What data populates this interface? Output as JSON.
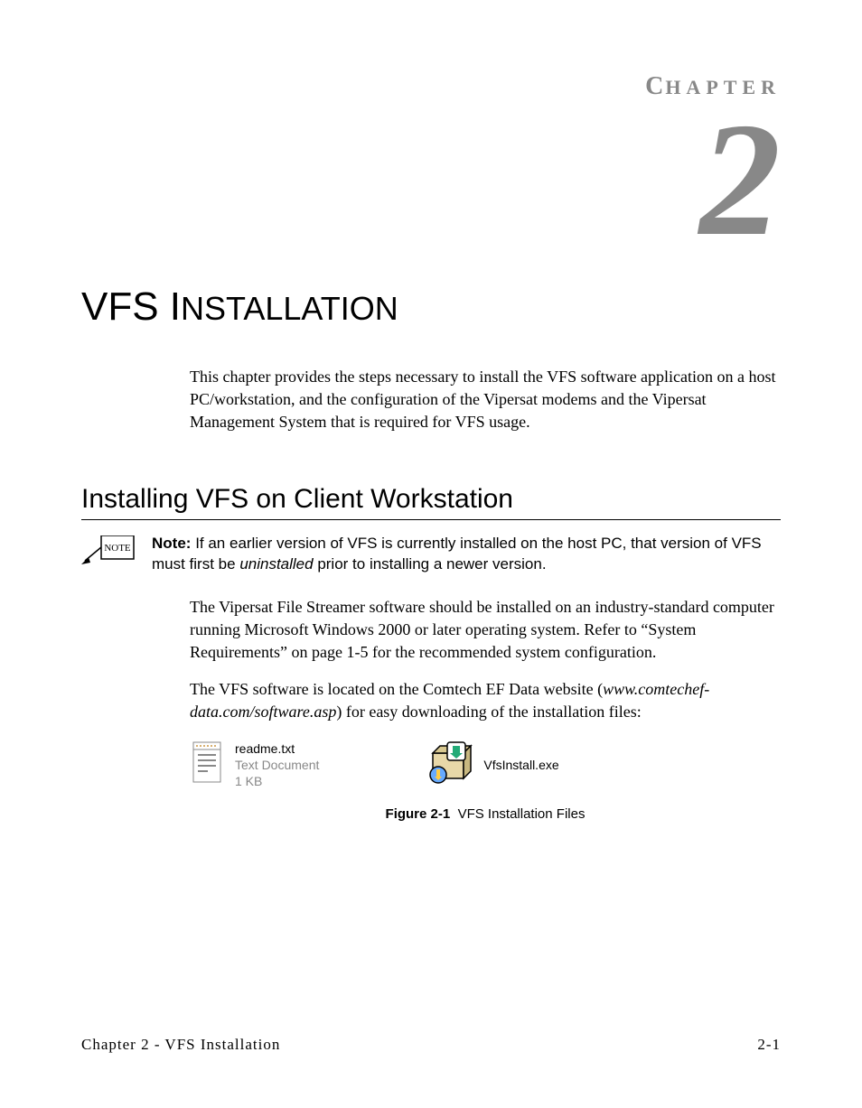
{
  "header": {
    "chapter_label": "HAPTER",
    "chapter_label_first": "C",
    "chapter_number": "2"
  },
  "title": {
    "main": "VFS I",
    "rest": "NSTALLATION"
  },
  "intro": "This chapter provides the steps necessary to install the VFS software application on a host PC/workstation, and the configuration of the Vipersat modems and the Vipersat Management System that is required for VFS usage.",
  "section": {
    "title": "Installing VFS on Client Workstation"
  },
  "note": {
    "label": "Note:",
    "body_prefix": "If an earlier version of VFS is currently installed on the host PC, that version of VFS must first be ",
    "body_emph": "uninstalled",
    "body_suffix": " prior to installing a newer version.",
    "icon_text": "NOTE"
  },
  "para1": "The Vipersat File Streamer software should be installed on an industry-standard computer running Microsoft Windows 2000 or later operating system. Refer to “System Requirements” on page 1-5 for the recommended system configuration.",
  "para2_prefix": "The VFS software is located on the Comtech EF Data website (",
  "para2_emph": "www.comtechef-data.com/software.asp",
  "para2_suffix": ") for easy downloading of the installation files:",
  "figure": {
    "file1": {
      "name": "readme.txt",
      "type": "Text Document",
      "size": "1 KB"
    },
    "file2": {
      "name": "VfsInstall.exe"
    },
    "caption_label": "Figure 2-1",
    "caption_text": "VFS Installation Files"
  },
  "footer": {
    "left": "Chapter 2 - VFS Installation",
    "right": "2-1"
  }
}
